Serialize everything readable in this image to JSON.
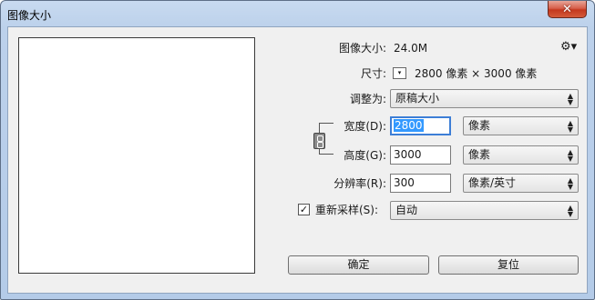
{
  "window": {
    "title": "图像大小",
    "close_label": "✕"
  },
  "info": {
    "image_size_label": "图像大小:",
    "image_size_value": "24.0M",
    "dimensions_label": "尺寸:",
    "dimensions_value": "2800 像素 × 3000 像素",
    "dimensions_dropdown_icon": "▾",
    "gear_icon": "⚙▾"
  },
  "fit_to": {
    "label": "调整为:",
    "value": "原稿大小",
    "arrows": "▲\n▼"
  },
  "width": {
    "label": "宽度(D):",
    "value": "2800",
    "unit": "像素"
  },
  "height": {
    "label": "高度(G):",
    "value": "3000",
    "unit": "像素"
  },
  "resolution": {
    "label": "分辨率(R):",
    "value": "300",
    "unit": "像素/英寸"
  },
  "resample": {
    "label": "重新采样(S):",
    "checked_mark": "✓",
    "value": "自动"
  },
  "buttons": {
    "ok": "确定",
    "reset": "复位"
  }
}
